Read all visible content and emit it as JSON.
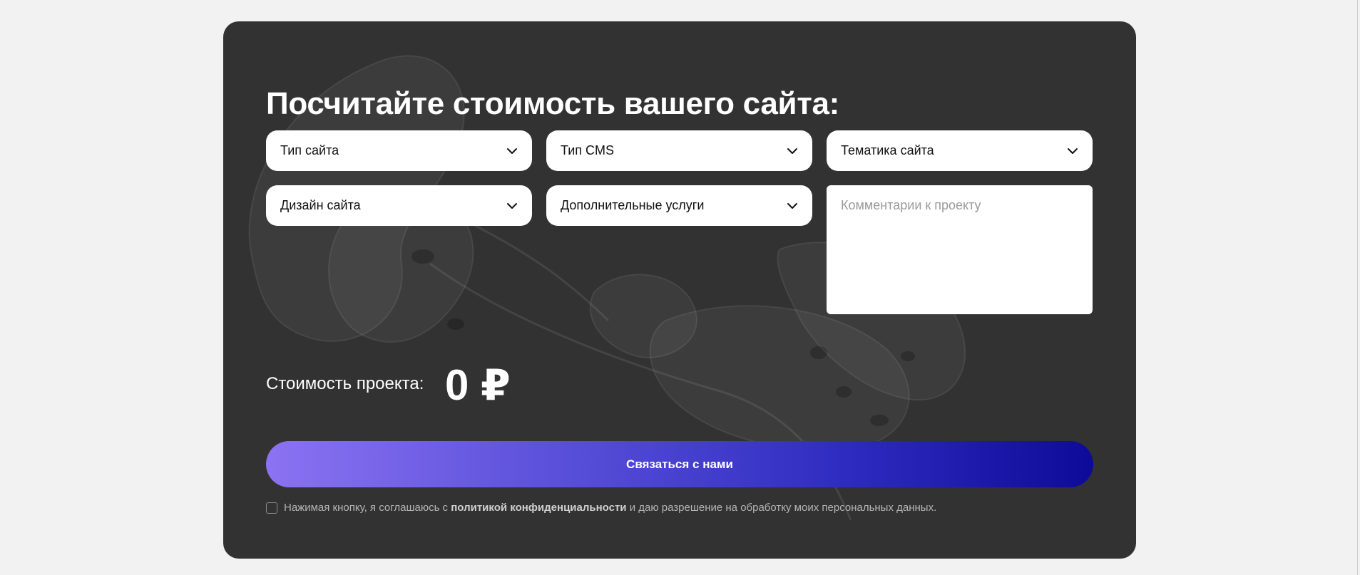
{
  "calculator": {
    "title": "Посчитайте стоимость вашего сайта:",
    "selects": [
      {
        "label": "Тип сайта"
      },
      {
        "label": "Тип CMS"
      },
      {
        "label": "Тематика сайта"
      },
      {
        "label": "Дизайн сайта"
      },
      {
        "label": "Дополнительные услуги"
      }
    ],
    "comment": {
      "placeholder": "Комментарии к проекту",
      "value": ""
    },
    "cost": {
      "label": "Стоимость проекта:",
      "value": "0 ₽"
    },
    "cta_label": "Связаться с нами",
    "consent": {
      "checked": false,
      "before": "Нажимая кнопку, я соглашаюсь с ",
      "link": "политикой конфиденциальности",
      "after": " и даю разрешение на обработку моих персональных данных."
    }
  },
  "icons": {
    "dropdown": "chevron-down-icon",
    "background": "flower-decoration"
  },
  "colors": {
    "page_bg": "#f2f2f2",
    "card_bg": "#323232",
    "button_gradient_start": "#8b73f2",
    "button_gradient_end": "#0e0a99",
    "text_on_dark": "#ffffff"
  }
}
